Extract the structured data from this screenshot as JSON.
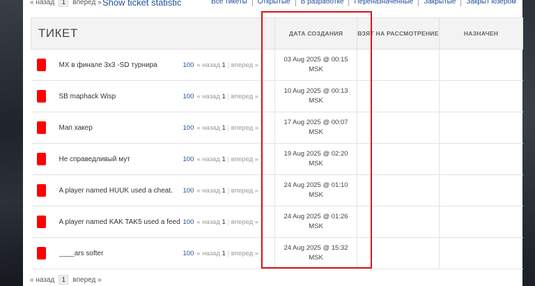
{
  "pager_top": {
    "prev": "« назад",
    "page": "1",
    "next": "вперед »"
  },
  "show_stats": "Show ticket statistic",
  "filters": [
    "Все тикеты",
    "Открытые",
    "В разработке",
    "Переназначенные",
    "Закрытые",
    "Закрыт юзером"
  ],
  "headers": {
    "ticket": "ТИКЕТ",
    "created": "ДАТА СОЗДАНИЯ",
    "taken": "ВЗЯТ НА РАССМОТРЕНИЕ",
    "assigned": "НАЗНАЧЕН"
  },
  "colors": {
    "flag": "#ff0000",
    "highlight": "#d9141b",
    "link": "#1f4f9a"
  },
  "rows": [
    {
      "title": "MX в финале 3х3 -SD турнира",
      "count": "100",
      "prev": "« назад",
      "page": "1",
      "next": "вперед »",
      "date": "03 Aug 2025 @ 00:15",
      "tz": "MSK"
    },
    {
      "title": "SB maphack Wisp",
      "count": "100",
      "prev": "« назад",
      "page": "1",
      "next": "вперед »",
      "date": "10 Aug 2025 @ 00:13",
      "tz": "MSK"
    },
    {
      "title": "Мап хакер",
      "count": "100",
      "prev": "« назад",
      "page": "1",
      "next": "вперед »",
      "date": "17 Aug 2025 @ 00:07",
      "tz": "MSK"
    },
    {
      "title": "Не справедливый мут",
      "count": "100",
      "prev": "« назад",
      "page": "1",
      "next": "вперед »",
      "date": "19 Aug 2025 @ 02:20",
      "tz": "MSK"
    },
    {
      "title": "A player named HUUK used a cheat.",
      "count": "100",
      "prev": "« назад",
      "page": "1",
      "next": "вперед »",
      "date": "24 Aug 2025 @ 01:10",
      "tz": "MSK"
    },
    {
      "title": "A player named KAK TAK5 used a feed",
      "count": "100",
      "prev": "« назад",
      "page": "1",
      "next": "вперед »",
      "date": "24 Aug 2025 @ 01:26",
      "tz": "MSK"
    },
    {
      "title": "____ars softer",
      "count": "100",
      "prev": "« назад",
      "page": "1",
      "next": "вперед »",
      "date": "24 Aug 2025 @ 15:32",
      "tz": "MSK"
    }
  ],
  "pager_bottom": {
    "prev": "« назад",
    "page": "1",
    "next": "вперед »"
  }
}
